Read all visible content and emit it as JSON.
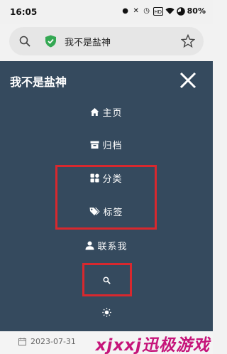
{
  "status_bar": {
    "time": "16:05",
    "battery": "80%",
    "icons": [
      "notification-icon",
      "mute-icon",
      "alarm-icon",
      "hd-icon",
      "wifi-icon",
      "battery-icon"
    ]
  },
  "address_bar": {
    "url_text": "我不是盐神",
    "icons": [
      "search-icon",
      "secure-shield-icon",
      "bookmark-star-icon"
    ]
  },
  "drawer": {
    "site_title": "我不是盐神",
    "bg_color": "#354a5e",
    "menu": [
      {
        "label": "主页",
        "icon": "home-icon"
      },
      {
        "label": "归档",
        "icon": "archive-icon"
      },
      {
        "label": "分类",
        "icon": "category-grid-icon"
      },
      {
        "label": "标签",
        "icon": "tags-icon"
      },
      {
        "label": "联系我",
        "icon": "user-icon"
      },
      {
        "label": "",
        "icon": "search-icon"
      },
      {
        "label": "",
        "icon": "theme-sun-icon"
      }
    ]
  },
  "highlight_color": "#d8282e",
  "bottom": {
    "date": "2023-07-31",
    "watermark": "xjxxj迅极游戏"
  }
}
